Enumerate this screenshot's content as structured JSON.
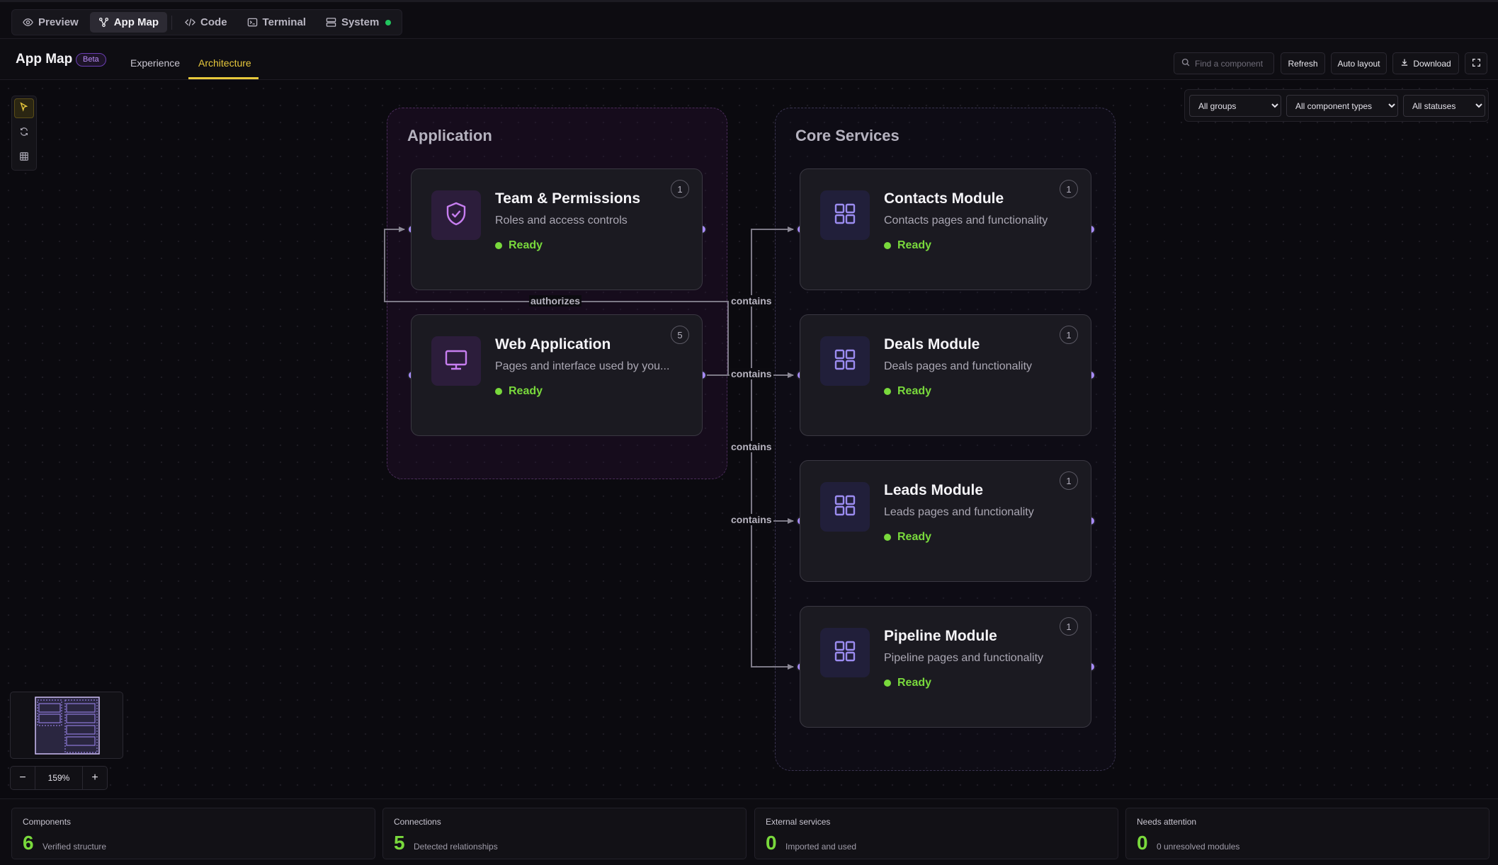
{
  "topbar": {
    "tabs": [
      {
        "label": "Preview",
        "icon": "eye-icon"
      },
      {
        "label": "App Map",
        "icon": "map-icon",
        "active": true
      },
      {
        "label": "Code",
        "icon": "code-icon"
      },
      {
        "label": "Terminal",
        "icon": "terminal-icon"
      },
      {
        "label": "System",
        "icon": "server-icon",
        "status_color": "#22c55e"
      }
    ]
  },
  "header": {
    "title": "App Map",
    "badge": "Beta",
    "tabs": [
      {
        "label": "Experience"
      },
      {
        "label": "Architecture",
        "active": true
      }
    ],
    "search_placeholder": "Find a component",
    "buttons": {
      "refresh": "Refresh",
      "auto_layout": "Auto layout",
      "download": "Download"
    }
  },
  "filters": {
    "groups": {
      "selected": "All groups"
    },
    "types": {
      "selected": "All component types"
    },
    "statuses": {
      "selected": "All statuses"
    }
  },
  "groups": {
    "application": {
      "title": "Application"
    },
    "core": {
      "title": "Core Services"
    }
  },
  "nodes": {
    "team": {
      "title": "Team & Permissions",
      "desc": "Roles and access controls",
      "status": "Ready",
      "count": "1",
      "icon": "shield-check-icon"
    },
    "web": {
      "title": "Web Application",
      "desc": "Pages and interface used by you...",
      "status": "Ready",
      "count": "5",
      "icon": "monitor-icon"
    },
    "contacts": {
      "title": "Contacts Module",
      "desc": "Contacts pages and functionality",
      "status": "Ready",
      "count": "1",
      "icon": "grid-icon"
    },
    "deals": {
      "title": "Deals Module",
      "desc": "Deals pages and functionality",
      "status": "Ready",
      "count": "1",
      "icon": "grid-icon"
    },
    "leads": {
      "title": "Leads Module",
      "desc": "Leads pages and functionality",
      "status": "Ready",
      "count": "1",
      "icon": "grid-icon"
    },
    "pipeline": {
      "title": "Pipeline Module",
      "desc": "Pipeline pages and functionality",
      "status": "Ready",
      "count": "1",
      "icon": "grid-icon"
    }
  },
  "edges": {
    "authorizes": "authorizes",
    "contains1": "contains",
    "contains2": "contains",
    "contains3": "contains",
    "contains4": "contains"
  },
  "zoom": {
    "level": "159%",
    "minus": "−",
    "plus": "+"
  },
  "stats": [
    {
      "label": "Components",
      "value": "6",
      "sub": "Verified structure"
    },
    {
      "label": "Connections",
      "value": "5",
      "sub": "Detected relationships"
    },
    {
      "label": "External services",
      "value": "0",
      "sub": "Imported and used"
    },
    {
      "label": "Needs attention",
      "value": "0",
      "sub": "0 unresolved modules"
    }
  ],
  "colors": {
    "accent": "#e7c83c",
    "ready": "#79d93c",
    "port": "#a78bfa"
  }
}
